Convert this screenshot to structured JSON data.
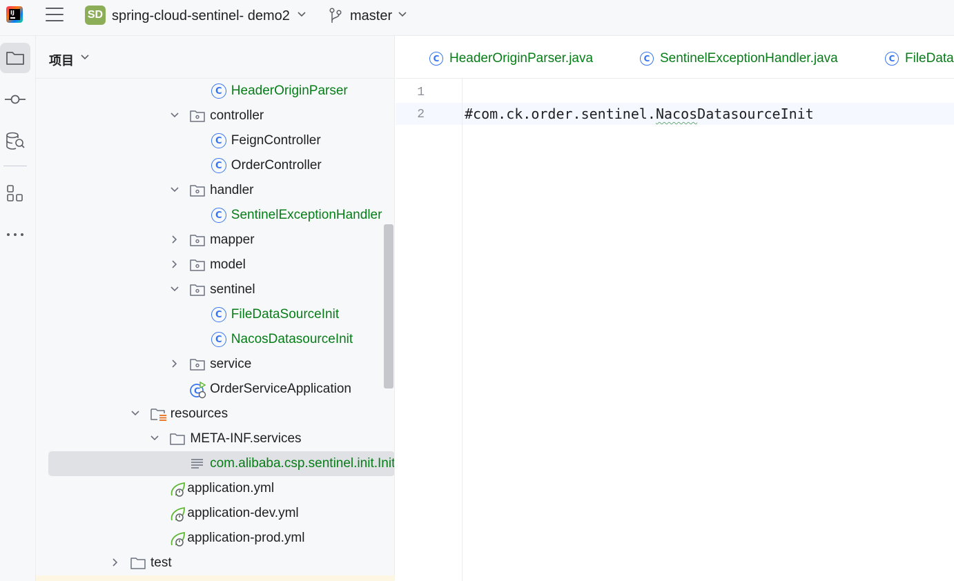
{
  "topbar": {
    "project_badge": "SD",
    "project_name": "spring-cloud-sentinel- demo2",
    "branch_name": "master"
  },
  "panel": {
    "title": "项目"
  },
  "tree": [
    {
      "label": "HeaderOriginParser",
      "kind": "class",
      "vcs": "added"
    },
    {
      "label": "controller",
      "kind": "package",
      "expanded": true
    },
    {
      "label": "FeignController",
      "kind": "class"
    },
    {
      "label": "OrderController",
      "kind": "class"
    },
    {
      "label": "handler",
      "kind": "package",
      "expanded": true
    },
    {
      "label": "SentinelExceptionHandler",
      "kind": "class",
      "vcs": "added"
    },
    {
      "label": "mapper",
      "kind": "package",
      "expanded": false
    },
    {
      "label": "model",
      "kind": "package",
      "expanded": false
    },
    {
      "label": "sentinel",
      "kind": "package",
      "expanded": true
    },
    {
      "label": "FileDataSourceInit",
      "kind": "class",
      "vcs": "added"
    },
    {
      "label": "NacosDatasourceInit",
      "kind": "class",
      "vcs": "added"
    },
    {
      "label": "service",
      "kind": "package",
      "expanded": false
    },
    {
      "label": "OrderServiceApplication",
      "kind": "spring-boot-class"
    },
    {
      "label": "resources",
      "kind": "resources-folder",
      "expanded": true
    },
    {
      "label": "META-INF.services",
      "kind": "folder",
      "expanded": true
    },
    {
      "label": "com.alibaba.csp.sentinel.init.InitFunc",
      "kind": "text-file",
      "vcs": "added",
      "selected": true
    },
    {
      "label": "application.yml",
      "kind": "spring-config"
    },
    {
      "label": "application-dev.yml",
      "kind": "spring-config"
    },
    {
      "label": "application-prod.yml",
      "kind": "spring-config"
    },
    {
      "label": "test",
      "kind": "folder",
      "expanded": false
    }
  ],
  "tabs": [
    {
      "label": "HeaderOriginParser.java"
    },
    {
      "label": "SentinelExceptionHandler.java"
    },
    {
      "label": "FileDataSourceInit.java"
    }
  ],
  "editor": {
    "line_numbers": [
      "1",
      "2"
    ],
    "lines": [
      "",
      "#com.ck.order.sentinel.NacosDatasourceInit"
    ]
  },
  "colors": {
    "vcs_added": "#067d17",
    "class_icon": "#3574f0",
    "selection": "#dfe1e5",
    "project_badge": "#8dae58"
  }
}
